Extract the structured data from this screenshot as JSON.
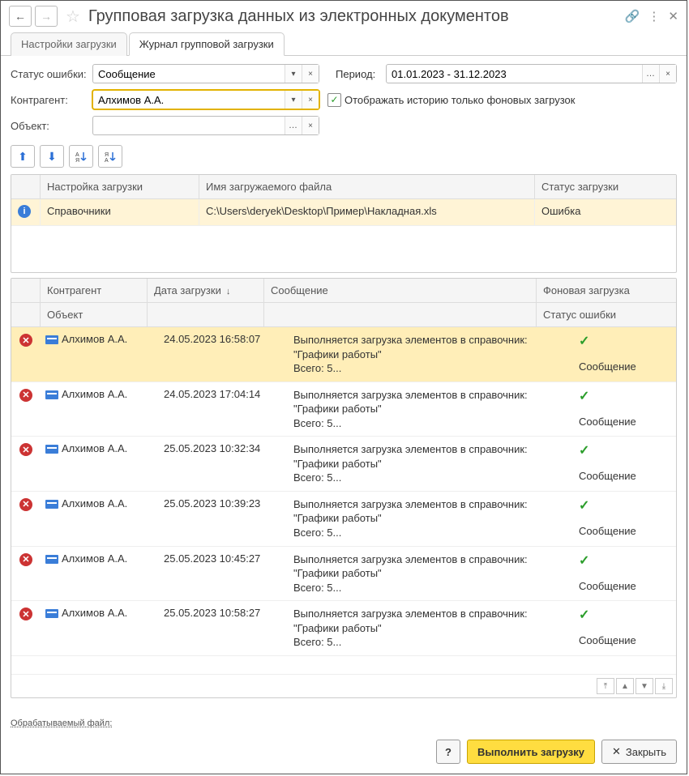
{
  "title": "Групповая загрузка данных из электронных документов",
  "tabs": {
    "settings": "Настройки загрузки",
    "journal": "Журнал групповой загрузки"
  },
  "filters": {
    "status_label": "Статус ошибки:",
    "status_value": "Сообщение",
    "period_label": "Период:",
    "period_value": "01.01.2023 - 31.12.2023",
    "contractor_label": "Контрагент:",
    "contractor_value": "Алхимов А.А.",
    "object_label": "Объект:",
    "object_value": "",
    "show_background_label": "Отображать историю только фоновых загрузок"
  },
  "table1": {
    "headers": {
      "setting": "Настройка загрузки",
      "filename": "Имя загружаемого файла",
      "status": "Статус загрузки"
    },
    "row": {
      "setting": "Справочники",
      "filename": "C:\\Users\\deryek\\Desktop\\Пример\\Накладная.xls",
      "status": "Ошибка"
    }
  },
  "table2": {
    "headers": {
      "contractor": "Контрагент",
      "date": "Дата загрузки",
      "message": "Сообщение",
      "background": "Фоновая загрузка",
      "object": "Объект",
      "err_status": "Статус ошибки"
    },
    "msg_template": "Выполняется загрузка элементов в справочник: \"Графики работы\"\nВсего: 5...",
    "status_text": "Сообщение",
    "rows": [
      {
        "contractor": "Алхимов А.А.",
        "date": "24.05.2023 16:58:07"
      },
      {
        "contractor": "Алхимов А.А.",
        "date": "24.05.2023 17:04:14"
      },
      {
        "contractor": "Алхимов А.А.",
        "date": "25.05.2023 10:32:34"
      },
      {
        "contractor": "Алхимов А.А.",
        "date": "25.05.2023 10:39:23"
      },
      {
        "contractor": "Алхимов А.А.",
        "date": "25.05.2023 10:45:27"
      },
      {
        "contractor": "Алхимов А.А.",
        "date": "25.05.2023 10:58:27"
      }
    ]
  },
  "link": "Обрабатываемый файл:",
  "footer": {
    "help": "?",
    "execute": "Выполнить загрузку",
    "close": "Закрыть"
  }
}
